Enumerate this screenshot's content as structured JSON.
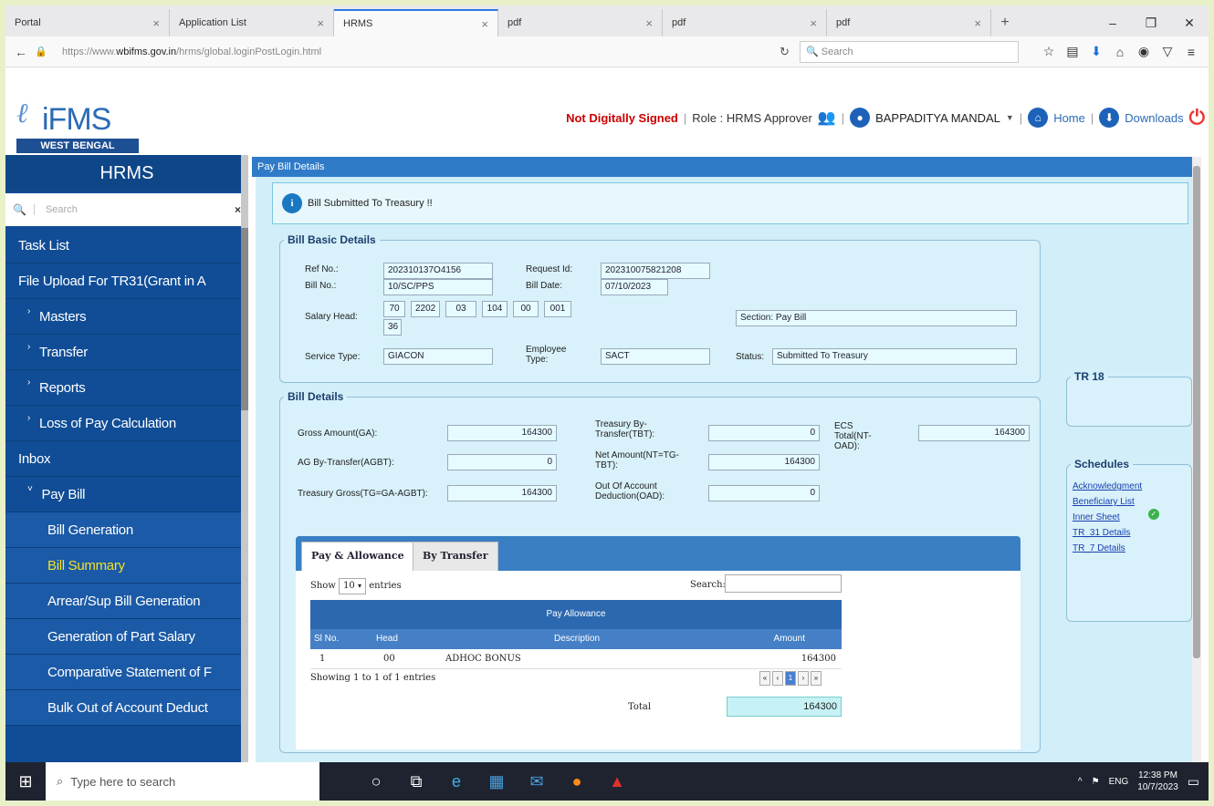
{
  "browser": {
    "tabs": [
      {
        "label": "Portal"
      },
      {
        "label": "Application List"
      },
      {
        "label": "HRMS",
        "active": true
      },
      {
        "label": "pdf"
      },
      {
        "label": "pdf"
      },
      {
        "label": "pdf"
      }
    ],
    "url_prefix": "https://www.",
    "url_domain": "wbifms.gov.in",
    "url_path": "/hrms/global.loginPostLogin.html",
    "search_placeholder": "Search"
  },
  "header": {
    "logo_text": "iFMS",
    "logo_band": "WEST BENGAL",
    "not_signed": "Not Digitally Signed",
    "role_label": "Role : HRMS Approver",
    "user_name": "BAPPADITYA MANDAL",
    "home_link": "Home",
    "downloads_link": "Downloads"
  },
  "sidebar": {
    "title": "HRMS",
    "search_placeholder": "Search",
    "items": [
      {
        "label": "Task List"
      },
      {
        "label": "File Upload For TR31(Grant in A"
      },
      {
        "label": "Masters"
      },
      {
        "label": "Transfer"
      },
      {
        "label": "Reports"
      },
      {
        "label": "Loss of Pay Calculation"
      },
      {
        "label": "Inbox"
      },
      {
        "label": "Pay Bill"
      },
      {
        "label": "Bill Generation"
      },
      {
        "label": "Bill Summary"
      },
      {
        "label": "Arrear/Sup Bill Generation"
      },
      {
        "label": "Generation of Part Salary"
      },
      {
        "label": "Comparative Statement of F"
      },
      {
        "label": "Bulk Out of Account Deduct"
      }
    ]
  },
  "main": {
    "section_title": "Pay Bill Details",
    "alert": "Bill Submitted To Treasury !!",
    "basic": {
      "legend": "Bill Basic Details",
      "ref_label": "Ref No.:",
      "ref_value": "202310137O4156",
      "request_label": "Request Id:",
      "request_value": "202310075821208",
      "billno_label": "Bill No.:",
      "billno_value": "10/SC/PPS",
      "billdate_label": "Bill Date:",
      "billdate_value": "07/10/2023",
      "salary_label": "Salary Head:",
      "salary_parts": [
        "70",
        "2202",
        "03",
        "104",
        "00",
        "001",
        "36"
      ],
      "section_label": "Section: Pay Bill",
      "service_label": "Service Type:",
      "service_value": "GIACON",
      "emp_label": "Employee Type:",
      "emp_value": "SACT",
      "status_label": "Status:",
      "status_value": "Submitted To Treasury"
    },
    "details": {
      "legend": "Bill Details",
      "gross_label": "Gross Amount(GA):",
      "gross_value": "164300",
      "tbt_label": "Treasury By-Transfer(TBT):",
      "tbt_value": "0",
      "ecs_label": "ECS Total(NT-OAD):",
      "ecs_value": "164300",
      "agbt_label": "AG By-Transfer(AGBT):",
      "agbt_value": "0",
      "net_label": "Net Amount(NT=TG-TBT):",
      "net_value": "164300",
      "tg_label": "Treasury Gross(TG=GA-AGBT):",
      "tg_value": "164300",
      "oad_label": "Out Of Account Deduction(OAD):",
      "oad_value": "0"
    },
    "tr18_legend": "TR 18",
    "schedules": {
      "legend": "Schedules",
      "links": [
        "Acknowledgment",
        "Beneficiary List",
        "Inner Sheet",
        "TR_31 Details",
        "TR_7 Details"
      ]
    },
    "table": {
      "tab_pay": "Pay & Allowance",
      "tab_transfer": "By Transfer",
      "show_label": "Show",
      "show_value": "10",
      "entries_label": "entries",
      "search_label": "Search:",
      "group_header": "Pay Allowance",
      "columns": [
        "Sl No.",
        "Head",
        "Description",
        "Amount"
      ],
      "rows": [
        [
          "1",
          "00",
          "ADHOC BONUS",
          "164300"
        ]
      ],
      "info": "Showing 1 to 1 of 1 entries",
      "total_label": "Total",
      "total_value": "164300",
      "page_current": "1"
    }
  },
  "taskbar": {
    "search_placeholder": "Type here to search",
    "lang": "ENG",
    "time": "12:38 PM",
    "date": "10/7/2023"
  }
}
